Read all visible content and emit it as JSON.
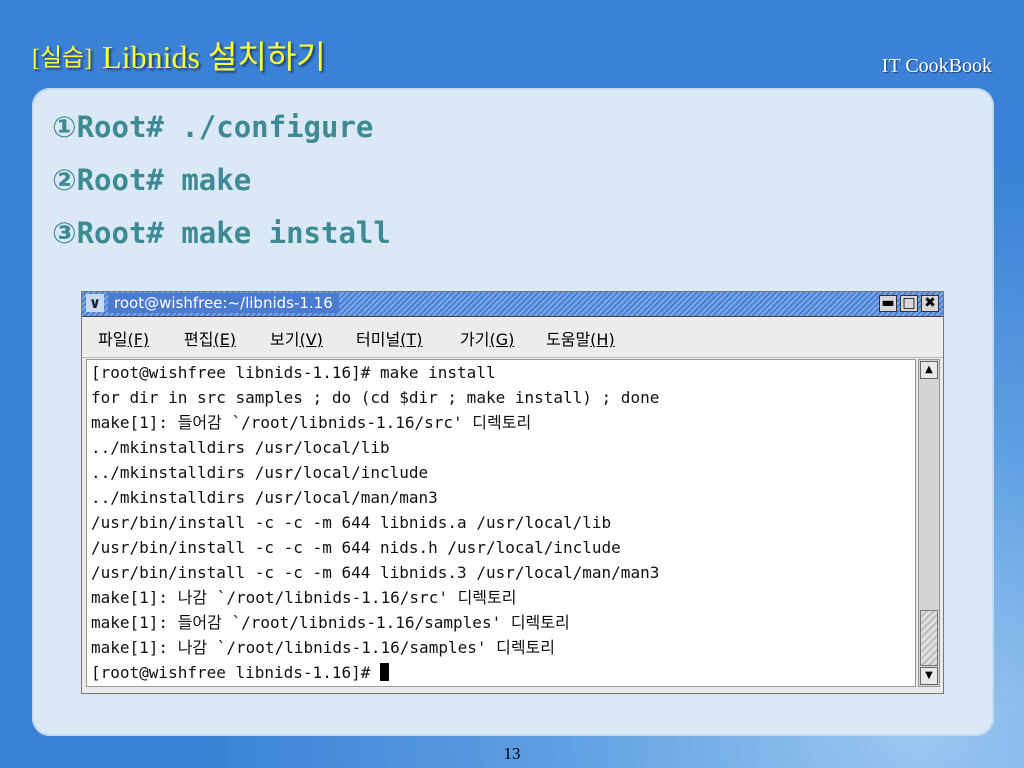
{
  "slide": {
    "title_tag": "[실습]",
    "title_main": "Libnids 설치하기",
    "brand": "IT CookBook",
    "page_number": "13"
  },
  "steps": [
    {
      "num": "①",
      "text": "Root# ./configure"
    },
    {
      "num": "②",
      "text": "Root# make"
    },
    {
      "num": "③",
      "text": "Root# make install"
    }
  ],
  "terminal": {
    "title": "root@wishfree:~/libnids-1.16",
    "menu_icon": "chevron-down-icon",
    "buttons": {
      "minimize": "▬",
      "maximize": "□",
      "close": "✖"
    },
    "menu": [
      {
        "label": "파일",
        "key": "(F)"
      },
      {
        "label": "편집",
        "key": "(E)"
      },
      {
        "label": "보기",
        "key": "(V)"
      },
      {
        "label": "터미널",
        "key": "(T)"
      },
      {
        "label": "가기",
        "key": "(G)"
      },
      {
        "label": "도움말",
        "key": "(H)"
      }
    ],
    "lines": [
      "[root@wishfree libnids-1.16]# make install",
      "for dir in src samples ; do (cd $dir ; make install) ; done",
      "make[1]: 들어감 `/root/libnids-1.16/src' 디렉토리",
      "../mkinstalldirs /usr/local/lib",
      "../mkinstalldirs /usr/local/include",
      "../mkinstalldirs /usr/local/man/man3",
      "/usr/bin/install -c -c -m 644 libnids.a /usr/local/lib",
      "/usr/bin/install -c -c -m 644 nids.h /usr/local/include",
      "/usr/bin/install -c -c -m 644 libnids.3 /usr/local/man/man3",
      "make[1]: 나감 `/root/libnids-1.16/src' 디렉토리",
      "make[1]: 들어감 `/root/libnids-1.16/samples' 디렉토리",
      "make[1]: 나감 `/root/libnids-1.16/samples' 디렉토리",
      "[root@wishfree libnids-1.16]# "
    ]
  },
  "colors": {
    "title": "#ffff33",
    "step_text": "#3d8a94",
    "background": "#3b82d6",
    "panel": "#dbe9f7"
  }
}
